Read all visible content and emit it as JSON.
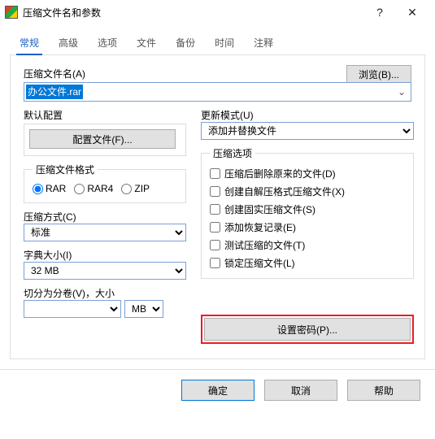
{
  "window": {
    "title": "压缩文件名和参数",
    "help_glyph": "?",
    "close_glyph": "✕"
  },
  "tabs": [
    "常规",
    "高级",
    "选项",
    "文件",
    "备份",
    "时间",
    "注释"
  ],
  "archive": {
    "name_label": "压缩文件名(A)",
    "name_value": "办公文件.rar",
    "browse_label": "浏览(B)..."
  },
  "profile": {
    "group_label": "默认配置",
    "button_label": "配置文件(F)..."
  },
  "update": {
    "label": "更新模式(U)",
    "selected": "添加并替换文件"
  },
  "format": {
    "group_label": "压缩文件格式",
    "options": [
      "RAR",
      "RAR4",
      "ZIP"
    ],
    "selected": "RAR"
  },
  "method": {
    "label": "压缩方式(C)",
    "selected": "标准"
  },
  "dict": {
    "label": "字典大小(I)",
    "selected": "32 MB"
  },
  "split": {
    "label": "切分为分卷(V)，大小",
    "unit": "MB"
  },
  "options": {
    "group_label": "压缩选项",
    "items": [
      "压缩后删除原来的文件(D)",
      "创建自解压格式压缩文件(X)",
      "创建固实压缩文件(S)",
      "添加恢复记录(E)",
      "测试压缩的文件(T)",
      "锁定压缩文件(L)"
    ]
  },
  "password_button": "设置密码(P)...",
  "buttons": {
    "ok": "确定",
    "cancel": "取消",
    "help": "帮助"
  }
}
